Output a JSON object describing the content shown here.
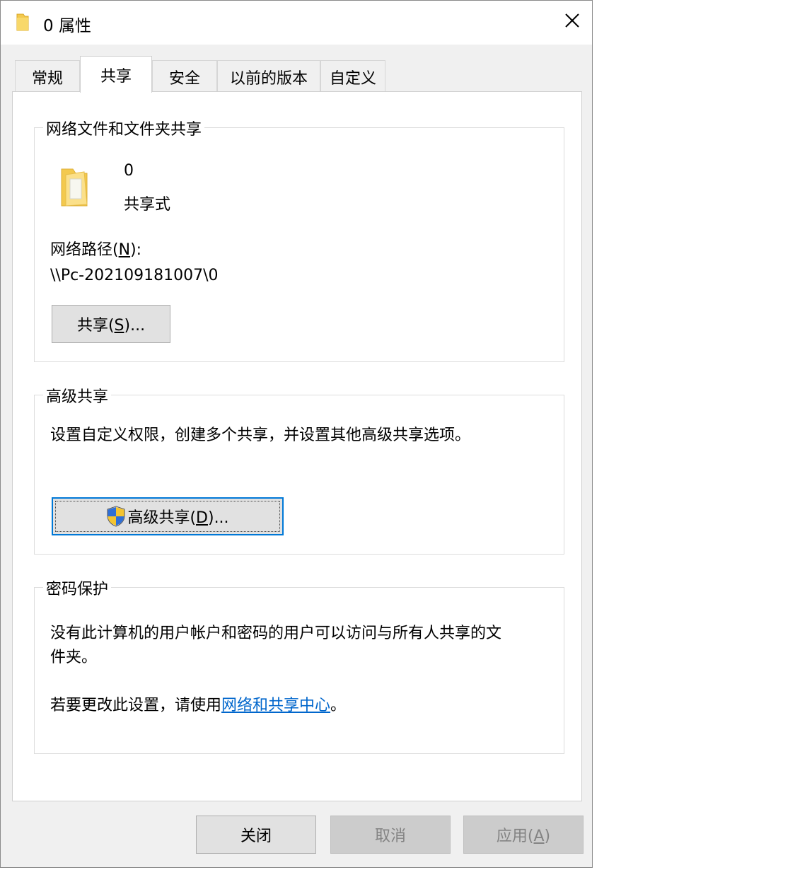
{
  "window": {
    "title": "0 属性",
    "colors": {
      "accent": "#0078d7",
      "link": "#0066cc",
      "folder": "#f3c94e"
    }
  },
  "tabs": [
    {
      "label": "常规"
    },
    {
      "label": "共享"
    },
    {
      "label": "安全"
    },
    {
      "label": "以前的版本"
    },
    {
      "label": "自定义"
    }
  ],
  "network_share": {
    "legend": "网络文件和文件夹共享",
    "folder_name": "0",
    "share_status": "共享式",
    "path_label_prefix": "网络路径(",
    "path_label_key": "N",
    "path_label_suffix": "):",
    "path_value": "\\\\Pc-202109181007\\0",
    "share_button_prefix": "共享(",
    "share_button_key": "S",
    "share_button_suffix": ")..."
  },
  "advanced_share": {
    "legend": "高级共享",
    "description": "设置自定义权限，创建多个共享，并设置其他高级共享选项。",
    "button_prefix": "高级共享(",
    "button_key": "D",
    "button_suffix": ")..."
  },
  "password_protection": {
    "legend": "密码保护",
    "description_line1": "没有此计算机的用户帐户和密码的用户可以访问与所有人共享的文",
    "description_line2": "件夹。",
    "change_prefix": "若要更改此设置，请使用",
    "change_link": "网络和共享中心",
    "change_suffix": "。"
  },
  "footer": {
    "close_label": "关闭",
    "cancel_label": "取消",
    "apply_prefix": "应用(",
    "apply_key": "A",
    "apply_suffix": ")"
  },
  "icons": {
    "title": "folder-icon",
    "close": "close-icon",
    "share_folder": "shared-folder-icon",
    "uac": "uac-shield-icon"
  }
}
